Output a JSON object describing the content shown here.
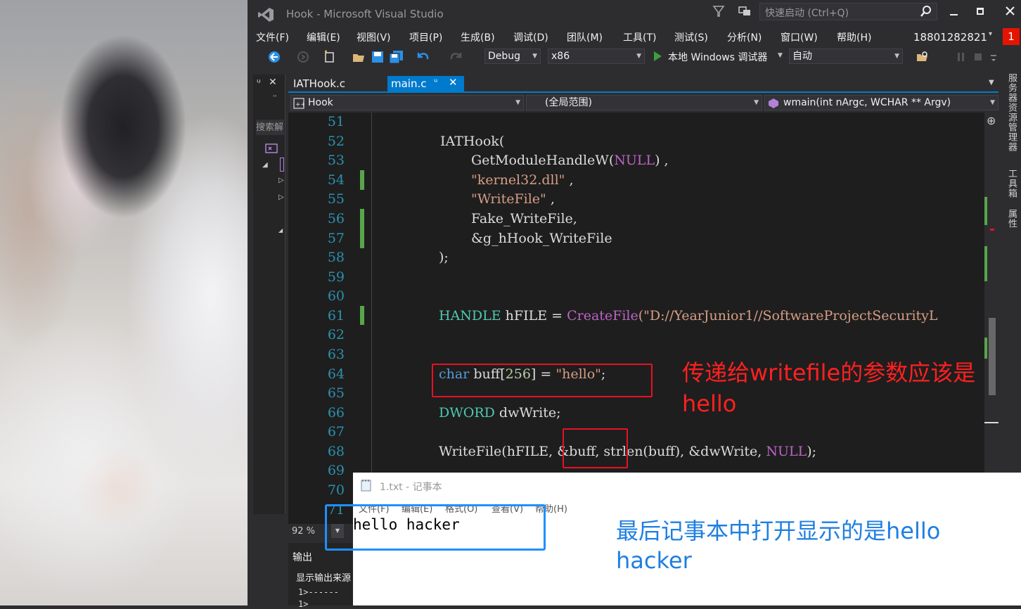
{
  "title_bar": {
    "title": "Hook - Microsoft Visual Studio",
    "quick_launch": "快速启动 (Ctrl+Q)",
    "badge": "1"
  },
  "menu": [
    "文件(F)",
    "编辑(E)",
    "视图(V)",
    "项目(P)",
    "生成(B)",
    "调试(D)",
    "团队(M)",
    "工具(T)",
    "测试(S)",
    "分析(N)",
    "窗口(W)",
    "帮助(H)"
  ],
  "account": "18801282821",
  "toolbar": {
    "config": "Debug",
    "platform": "x86",
    "debugger": "本地 Windows 调试器",
    "mode": "自动"
  },
  "left_panel": {
    "pin": "ᵘ ✕",
    "search": "搜索解"
  },
  "tabs": [
    {
      "label": "IATHook.c",
      "active": false
    },
    {
      "label": "main.c",
      "active": true
    }
  ],
  "nav": {
    "project": "Hook",
    "scope": "(全局范围)",
    "member": "wmain(int nArgc, WCHAR ** Argv)"
  },
  "line_numbers": [
    "51",
    "52",
    "53",
    "54",
    "55",
    "56",
    "57",
    "58",
    "59",
    "60",
    "61",
    "62",
    "63",
    "64",
    "65",
    "66",
    "67",
    "68",
    "69",
    "70",
    "71"
  ],
  "code": {
    "l52": "IATHook(",
    "l53a": "GetModuleHandleW(",
    "l53b": "NULL",
    "l53c": ") ,",
    "l54": "\"kernel32.dll\"",
    "l54b": " ,",
    "l55": "\"WriteFile\"",
    "l55b": " ,",
    "l56": "Fake_WriteFile,",
    "l57": "&g_hHook_WriteFile",
    "l58": ");",
    "l61a": "HANDLE",
    "l61b": " hFILE = ",
    "l61c": "CreateFile",
    "l61d": "(\"D://YearJunior1//SoftwareProjectSecurityL",
    "l64a": "char",
    "l64b": " buff[",
    "l64c": "256",
    "l64d": "] = ",
    "l64e": "\"hello\"",
    "l64f": ";",
    "l66a": "DWORD",
    "l66b": " dwWrite;",
    "l68a": "WriteFile(hFILE, &buff, strlen(buff), &dwWrite, ",
    "l68b": "NULL",
    "l68c": ");"
  },
  "zoom": "92 %",
  "output_panel": {
    "title": "输出",
    "source_label": "显示输出来源",
    "line1": "1>------ ",
    "line2": "1>  "
  },
  "notepad": {
    "title": "1.txt - 记事本",
    "menu": [
      "文件(F)",
      "编辑(E)",
      "格式(O)",
      "查看(V)",
      "帮助(H)"
    ],
    "content": "hello hacker"
  },
  "annotations": {
    "red_line1": "传递给writefile的参数应该是",
    "red_line2": "hello",
    "blue_line1": "最后记事本中打开显示的是hello",
    "blue_line2": "hacker"
  },
  "side_tabs": [
    "服务器资源管理器",
    "工具箱",
    "属性"
  ],
  "colors": {
    "keyword": "#569cd6",
    "string": "#d69d85",
    "macro": "#bd63c5",
    "type": "#4ec9b0",
    "line_number": "#2b91af",
    "annotation_red": "#ff2020",
    "annotation_blue": "#1e7fe0",
    "active_tab": "#007acc"
  }
}
